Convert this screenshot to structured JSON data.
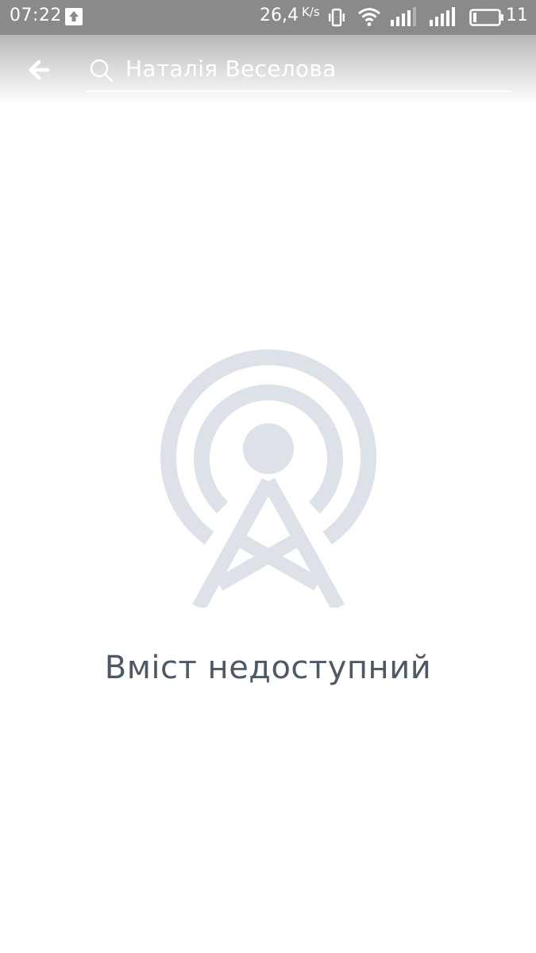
{
  "status_bar": {
    "time": "07:22",
    "speed_value": "26,4",
    "speed_unit": "K/s",
    "battery_percent": "11",
    "icons": [
      "upload-icon",
      "vibrate-icon",
      "wifi-icon",
      "signal-icon",
      "signal-icon",
      "battery-icon"
    ]
  },
  "header": {
    "back_icon": "arrow-left-icon",
    "search_icon": "search-icon",
    "search_value": "Наталія Веселова"
  },
  "empty_state": {
    "icon": "broadcast-tower-icon",
    "message": "Вміст недоступний",
    "icon_color": "#dde1e8",
    "text_color": "#4e5966"
  }
}
